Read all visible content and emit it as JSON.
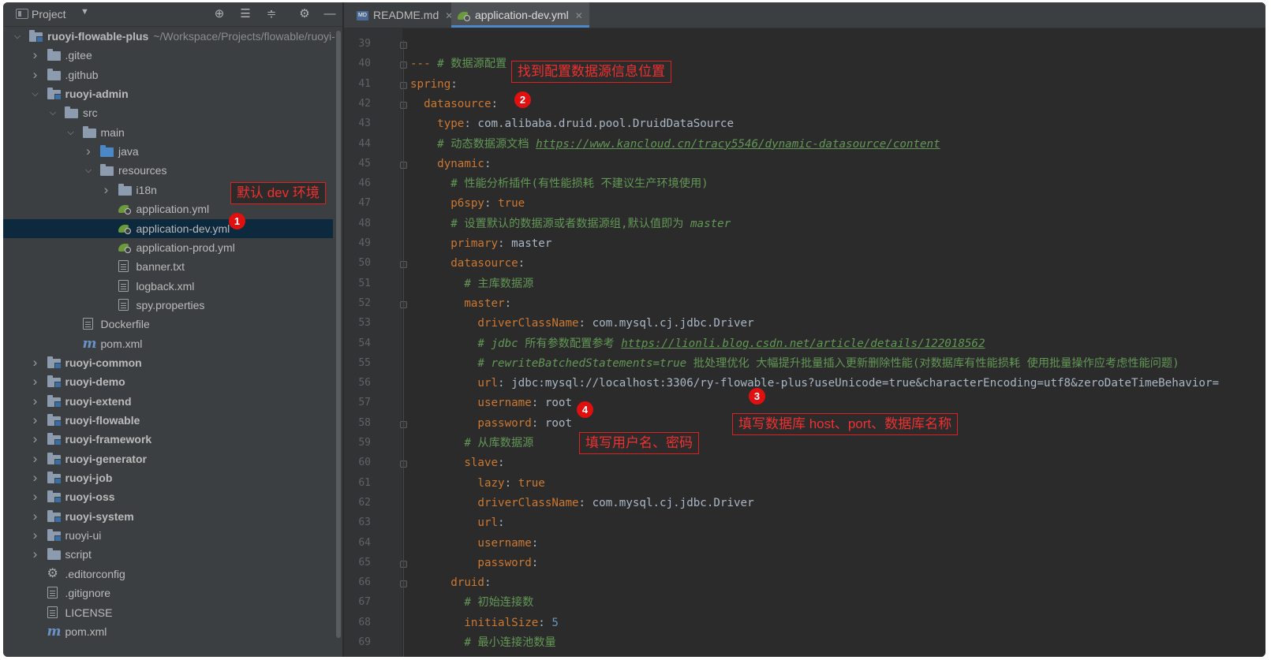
{
  "project_panel": {
    "title": "Project",
    "tree": [
      {
        "label": "ruoyi-flowable-plus",
        "hint": "~/Workspace/Projects/flowable/ruoyi-",
        "bold": true,
        "icon": "module-folder-icon",
        "arrow": "expanded"
      },
      {
        "label": ".gitee",
        "icon": "folder-icon",
        "arrow": "collapsed"
      },
      {
        "label": ".github",
        "icon": "folder-icon",
        "arrow": "collapsed"
      },
      {
        "label": "ruoyi-admin",
        "bold": true,
        "icon": "module-folder-icon",
        "arrow": "expanded"
      },
      {
        "label": "src",
        "icon": "folder-icon",
        "arrow": "expanded"
      },
      {
        "label": "main",
        "icon": "folder-icon",
        "arrow": "expanded"
      },
      {
        "label": "java",
        "icon": "source-folder-icon",
        "arrow": "collapsed"
      },
      {
        "label": "resources",
        "icon": "resources-folder-icon",
        "arrow": "expanded"
      },
      {
        "label": "i18n",
        "icon": "folder-icon",
        "arrow": "collapsed"
      },
      {
        "label": "application.yml",
        "icon": "yaml-icon"
      },
      {
        "label": "application-dev.yml",
        "icon": "yaml-icon",
        "selected": true
      },
      {
        "label": "application-prod.yml",
        "icon": "yaml-icon"
      },
      {
        "label": "banner.txt",
        "icon": "text-file-icon"
      },
      {
        "label": "logback.xml",
        "icon": "xml-file-icon"
      },
      {
        "label": "spy.properties",
        "icon": "properties-file-icon"
      },
      {
        "label": "Dockerfile",
        "icon": "docker-icon"
      },
      {
        "label": "pom.xml",
        "icon": "maven-icon"
      },
      {
        "label": "ruoyi-common",
        "bold": true,
        "icon": "module-folder-icon",
        "arrow": "collapsed"
      },
      {
        "label": "ruoyi-demo",
        "bold": true,
        "icon": "module-folder-icon",
        "arrow": "collapsed"
      },
      {
        "label": "ruoyi-extend",
        "bold": true,
        "icon": "module-folder-icon",
        "arrow": "collapsed"
      },
      {
        "label": "ruoyi-flowable",
        "bold": true,
        "icon": "module-folder-icon",
        "arrow": "collapsed"
      },
      {
        "label": "ruoyi-framework",
        "bold": true,
        "icon": "module-folder-icon",
        "arrow": "collapsed"
      },
      {
        "label": "ruoyi-generator",
        "bold": true,
        "icon": "module-folder-icon",
        "arrow": "collapsed"
      },
      {
        "label": "ruoyi-job",
        "bold": true,
        "icon": "module-folder-icon",
        "arrow": "collapsed"
      },
      {
        "label": "ruoyi-oss",
        "bold": true,
        "icon": "module-folder-icon",
        "arrow": "collapsed"
      },
      {
        "label": "ruoyi-system",
        "bold": true,
        "icon": "module-folder-icon",
        "arrow": "collapsed"
      },
      {
        "label": "ruoyi-ui",
        "icon": "module-folder-icon",
        "arrow": "collapsed"
      },
      {
        "label": "script",
        "icon": "folder-icon",
        "arrow": "collapsed"
      },
      {
        "label": ".editorconfig",
        "icon": "settings-file-icon"
      },
      {
        "label": ".gitignore",
        "icon": "ignore-file-icon"
      },
      {
        "label": "LICENSE",
        "icon": "text-file-icon"
      },
      {
        "label": "pom.xml",
        "icon": "maven-icon"
      }
    ]
  },
  "editor": {
    "tabs": [
      {
        "label": "README.md",
        "icon": "markdown-icon",
        "active": false
      },
      {
        "label": "application-dev.yml",
        "icon": "yaml-icon",
        "active": true
      }
    ],
    "lines": [
      {
        "n": "39",
        "segs": []
      },
      {
        "n": "40",
        "segs": [
          {
            "t": "--- ",
            "c": "sep"
          },
          {
            "t": "# 数据源配置",
            "c": "cz"
          }
        ]
      },
      {
        "n": "41",
        "segs": [
          {
            "t": "spring",
            "c": "k"
          },
          {
            "t": ":",
            "c": "s"
          }
        ]
      },
      {
        "n": "42",
        "segs": [
          {
            "t": "  datasource",
            "c": "k"
          },
          {
            "t": ":",
            "c": "s"
          }
        ]
      },
      {
        "n": "43",
        "segs": [
          {
            "t": "    type",
            "c": "k"
          },
          {
            "t": ": com.alibaba.druid.pool.DruidDataSource",
            "c": "s"
          }
        ]
      },
      {
        "n": "44",
        "segs": [
          {
            "t": "    # 动态数据源文档 ",
            "c": "cz"
          },
          {
            "t": "https://www.kancloud.cn/tracy5546/dynamic-datasource/content",
            "c": "u"
          }
        ]
      },
      {
        "n": "45",
        "segs": [
          {
            "t": "    dynamic",
            "c": "k"
          },
          {
            "t": ":",
            "c": "s"
          }
        ]
      },
      {
        "n": "46",
        "segs": [
          {
            "t": "      # 性能分析插件(有性能损耗 不建议生产环境使用)",
            "c": "cz"
          }
        ]
      },
      {
        "n": "47",
        "segs": [
          {
            "t": "      p6spy",
            "c": "k"
          },
          {
            "t": ": ",
            "c": "s"
          },
          {
            "t": "true",
            "c": "b"
          }
        ]
      },
      {
        "n": "48",
        "segs": [
          {
            "t": "      # 设置默认的数据源或者数据源组,默认值即为 ",
            "c": "cz"
          },
          {
            "t": "master",
            "c": "c"
          }
        ]
      },
      {
        "n": "49",
        "segs": [
          {
            "t": "      primary",
            "c": "k"
          },
          {
            "t": ": master",
            "c": "s"
          }
        ]
      },
      {
        "n": "50",
        "segs": [
          {
            "t": "      datasource",
            "c": "k"
          },
          {
            "t": ":",
            "c": "s"
          }
        ]
      },
      {
        "n": "51",
        "segs": [
          {
            "t": "        # 主库数据源",
            "c": "cz"
          }
        ]
      },
      {
        "n": "52",
        "segs": [
          {
            "t": "        master",
            "c": "k"
          },
          {
            "t": ":",
            "c": "s"
          }
        ]
      },
      {
        "n": "53",
        "segs": [
          {
            "t": "          driverClassName",
            "c": "k"
          },
          {
            "t": ": com.mysql.cj.jdbc.Driver",
            "c": "s"
          }
        ]
      },
      {
        "n": "54",
        "segs": [
          {
            "t": "          # jdbc ",
            "c": "c"
          },
          {
            "t": "所有参数配置参考 ",
            "c": "cz"
          },
          {
            "t": "https://lionli.blog.csdn.net/article/details/122018562",
            "c": "u"
          }
        ]
      },
      {
        "n": "55",
        "segs": [
          {
            "t": "          # rewriteBatchedStatements=true ",
            "c": "c"
          },
          {
            "t": "批处理优化 大幅提升批量插入更新删除性能(对数据库有性能损耗 使用批量操作应考虑性能问题)",
            "c": "cz"
          }
        ]
      },
      {
        "n": "56",
        "segs": [
          {
            "t": "          url",
            "c": "k"
          },
          {
            "t": ": jdbc:mysql://localhost:3306/ry-flowable-plus?useUnicode=true&characterEncoding=utf8&zeroDateTimeBehavior=",
            "c": "s"
          }
        ]
      },
      {
        "n": "57",
        "segs": [
          {
            "t": "          username",
            "c": "k"
          },
          {
            "t": ": root",
            "c": "s"
          }
        ]
      },
      {
        "n": "58",
        "segs": [
          {
            "t": "          password",
            "c": "k"
          },
          {
            "t": ": root",
            "c": "s"
          }
        ]
      },
      {
        "n": "59",
        "segs": [
          {
            "t": "        # 从库数据源",
            "c": "cz"
          }
        ]
      },
      {
        "n": "60",
        "segs": [
          {
            "t": "        slave",
            "c": "k"
          },
          {
            "t": ":",
            "c": "s"
          }
        ]
      },
      {
        "n": "61",
        "segs": [
          {
            "t": "          lazy",
            "c": "k"
          },
          {
            "t": ": ",
            "c": "s"
          },
          {
            "t": "true",
            "c": "b"
          }
        ]
      },
      {
        "n": "62",
        "segs": [
          {
            "t": "          driverClassName",
            "c": "k"
          },
          {
            "t": ": com.mysql.cj.jdbc.Driver",
            "c": "s"
          }
        ]
      },
      {
        "n": "63",
        "segs": [
          {
            "t": "          url",
            "c": "k"
          },
          {
            "t": ":",
            "c": "s"
          }
        ]
      },
      {
        "n": "64",
        "segs": [
          {
            "t": "          username",
            "c": "k"
          },
          {
            "t": ":",
            "c": "s"
          }
        ]
      },
      {
        "n": "65",
        "segs": [
          {
            "t": "          password",
            "c": "k"
          },
          {
            "t": ":",
            "c": "s"
          }
        ]
      },
      {
        "n": "66",
        "segs": [
          {
            "t": "      druid",
            "c": "k"
          },
          {
            "t": ":",
            "c": "s"
          }
        ]
      },
      {
        "n": "67",
        "segs": [
          {
            "t": "        # 初始连接数",
            "c": "cz"
          }
        ]
      },
      {
        "n": "68",
        "segs": [
          {
            "t": "        initialSize",
            "c": "k"
          },
          {
            "t": ": ",
            "c": "s"
          },
          {
            "t": "5",
            "c": "n"
          }
        ]
      },
      {
        "n": "69",
        "segs": [
          {
            "t": "        # 最小连接池数量",
            "c": "cz"
          }
        ]
      }
    ]
  },
  "annotations": {
    "note_dev": "默认 dev 环境",
    "note_datasource": "找到配置数据源信息位置",
    "note_host": "填写数据库 host、port、数据库名称",
    "note_user": "填写用户名、密码",
    "badge1": "1",
    "badge2": "2",
    "badge3": "3",
    "badge4": "4",
    "color": "#e02020"
  }
}
